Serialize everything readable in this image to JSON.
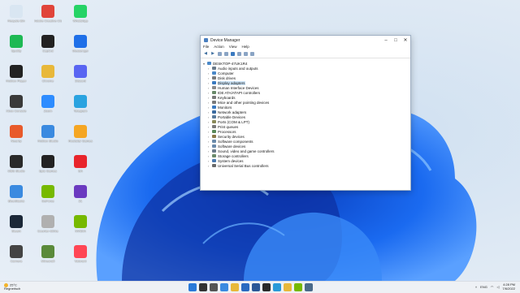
{
  "desktop_icons": [
    {
      "label": "Recycle Bin",
      "icon": "recycle-bin-icon",
      "color": "#d9e6f2"
    },
    {
      "label": "Spotify",
      "icon": "spotify-icon",
      "color": "#1db954"
    },
    {
      "label": "Roblox Player",
      "icon": "roblox-icon",
      "color": "#222222"
    },
    {
      "label": "Xbox Console",
      "icon": "xbox-icon",
      "color": "#3a3a3a"
    },
    {
      "label": "Nearby",
      "icon": "nearby-icon",
      "color": "#e85a2b"
    },
    {
      "label": "OBS Studio",
      "icon": "obs-icon",
      "color": "#2a2a2a"
    },
    {
      "label": "BlueStacks",
      "icon": "bluestacks-icon",
      "color": "#3a8ae0"
    },
    {
      "label": "Steam",
      "icon": "steam-icon",
      "color": "#1b2838"
    },
    {
      "label": "Camera",
      "icon": "camera-icon",
      "color": "#444444"
    },
    {
      "label": "Adobe Creative Cloud",
      "icon": "creative-cloud-icon",
      "color": "#e0443a"
    },
    {
      "label": "CapCut",
      "icon": "capcut-icon",
      "color": "#222222"
    },
    {
      "label": "Chrome",
      "icon": "chrome-icon",
      "color": "#e8b83a"
    },
    {
      "label": "Zoom",
      "icon": "zoom-icon",
      "color": "#2d8cff"
    },
    {
      "label": "Roblox Studio",
      "icon": "roblox-studio-icon",
      "color": "#3a8ae0"
    },
    {
      "label": "Epic Games",
      "icon": "epic-icon",
      "color": "#222222"
    },
    {
      "label": "GeForce",
      "icon": "geforce-icon",
      "color": "#76b900"
    },
    {
      "label": "Counter-Strike",
      "icon": "cs-icon",
      "color": "#b0b0b0"
    },
    {
      "label": "Minecraft",
      "icon": "minecraft-icon",
      "color": "#5a8a3a"
    },
    {
      "label": "WhatsApp",
      "icon": "whatsapp-icon",
      "color": "#25d366"
    },
    {
      "label": "Messenger",
      "icon": "messenger-icon",
      "color": "#1e6fe8"
    },
    {
      "label": "Discord",
      "icon": "discord-icon",
      "color": "#5865f2"
    },
    {
      "label": "Telegram",
      "icon": "telegram-icon",
      "color": "#2aa3e0"
    },
    {
      "label": "Rockstar Games",
      "icon": "rockstar-icon",
      "color": "#f5a623"
    },
    {
      "label": "EA",
      "icon": "ea-icon",
      "color": "#e8242b"
    },
    {
      "label": "21",
      "icon": "game-icon",
      "color": "#6a3ac0"
    },
    {
      "label": "NVIDIA",
      "icon": "nvidia-icon",
      "color": "#76b900"
    },
    {
      "label": "Valorant",
      "icon": "valorant-icon",
      "color": "#ff4655"
    }
  ],
  "window": {
    "title": "Device Manager",
    "menu": [
      "File",
      "Action",
      "View",
      "Help"
    ],
    "root": "DESKTOP-47UK1R4",
    "nodes": [
      {
        "label": "Audio inputs and outputs",
        "icon": "speaker-icon",
        "color": "#6a7a8a"
      },
      {
        "label": "Computer",
        "icon": "computer-icon",
        "color": "#4a88c8"
      },
      {
        "label": "Disk drives",
        "icon": "disk-icon",
        "color": "#7a7a7a"
      },
      {
        "label": "Display adapters",
        "icon": "display-icon",
        "color": "#3a7ac0",
        "selected": true
      },
      {
        "label": "Human Interface Devices",
        "icon": "hid-icon",
        "color": "#8a8a8a"
      },
      {
        "label": "IDE ATA/ATAPI controllers",
        "icon": "ide-icon",
        "color": "#6a8a6a"
      },
      {
        "label": "Keyboards",
        "icon": "keyboard-icon",
        "color": "#7a7a7a"
      },
      {
        "label": "Mice and other pointing devices",
        "icon": "mouse-icon",
        "color": "#7a7a7a"
      },
      {
        "label": "Monitors",
        "icon": "monitor-icon",
        "color": "#3a7ac0"
      },
      {
        "label": "Network adapters",
        "icon": "network-icon",
        "color": "#3a6aa0"
      },
      {
        "label": "Portable Devices",
        "icon": "portable-icon",
        "color": "#5a7a9a"
      },
      {
        "label": "Ports (COM & LPT)",
        "icon": "port-icon",
        "color": "#8a8a5a"
      },
      {
        "label": "Print queues",
        "icon": "printer-icon",
        "color": "#7a7a7a"
      },
      {
        "label": "Processors",
        "icon": "processor-icon",
        "color": "#5a8a5a"
      },
      {
        "label": "Security devices",
        "icon": "security-icon",
        "color": "#8a7a4a"
      },
      {
        "label": "Software components",
        "icon": "software-icon",
        "color": "#6a8aaa"
      },
      {
        "label": "Software devices",
        "icon": "software-device-icon",
        "color": "#6a8aaa"
      },
      {
        "label": "Sound, video and game controllers",
        "icon": "sound-icon",
        "color": "#6a7a8a"
      },
      {
        "label": "Storage controllers",
        "icon": "storage-icon",
        "color": "#6a8a6a"
      },
      {
        "label": "System devices",
        "icon": "system-icon",
        "color": "#4a7ab0"
      },
      {
        "label": "Universal Serial Bus controllers",
        "icon": "usb-icon",
        "color": "#6a6a6a"
      }
    ]
  },
  "taskbar": {
    "weather_temp": "25°C",
    "weather_desc": "Regnerisch",
    "apps": [
      {
        "icon": "start-icon",
        "color": "#2a7ad8"
      },
      {
        "icon": "search-icon",
        "color": "#333333"
      },
      {
        "icon": "task-view-icon",
        "color": "#555555"
      },
      {
        "icon": "widgets-icon",
        "color": "#3a8ae0"
      },
      {
        "icon": "file-explorer-icon",
        "color": "#e8b83a"
      },
      {
        "icon": "store-icon",
        "color": "#2a6ac0"
      },
      {
        "icon": "word-icon",
        "color": "#2b5797"
      },
      {
        "icon": "obs-icon",
        "color": "#2a2a2a"
      },
      {
        "icon": "edge-icon",
        "color": "#2a9ad8"
      },
      {
        "icon": "chrome-icon",
        "color": "#e8b83a"
      },
      {
        "icon": "nvidia-icon",
        "color": "#76b900"
      },
      {
        "icon": "device-manager-icon",
        "color": "#4a6a8a"
      }
    ],
    "lang": "ENG",
    "time": "4:28 PM",
    "date": "7/6/2022"
  }
}
